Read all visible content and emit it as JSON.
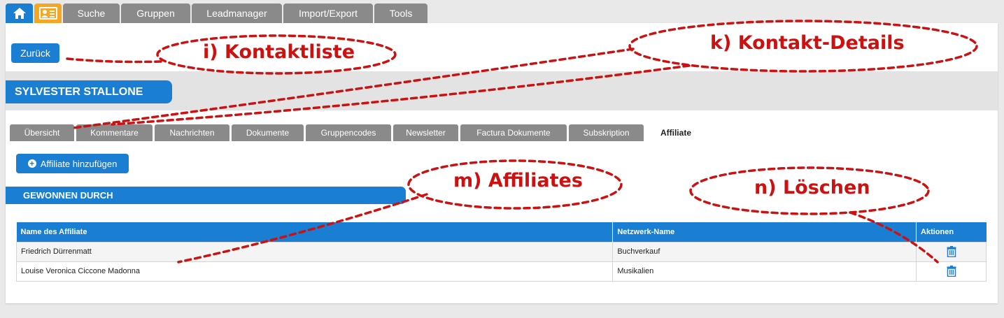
{
  "topnav": {
    "icons": [
      "home-icon",
      "contact-card-icon"
    ],
    "tabs": [
      "Suche",
      "Gruppen",
      "Leadmanager",
      "Import/Export",
      "Tools"
    ]
  },
  "back_label": "Zurück",
  "contact_name": "SYLVESTER STALLONE",
  "subtabs": [
    "Übersicht",
    "Kommentare",
    "Nachrichten",
    "Dokumente",
    "Gruppencodes",
    "Newsletter",
    "Factura Dokumente",
    "Subskription",
    "Affiliate"
  ],
  "active_subtab": "Affiliate",
  "add_affiliate_label": "Affiliate hinzufügen",
  "section_title": "GEWONNEN DURCH",
  "table": {
    "headers": [
      "Name des Affiliate",
      "Netzwerk-Name",
      "Aktionen"
    ],
    "rows": [
      {
        "name": "Friedrich Dürrenmatt",
        "network": "Buchverkauf",
        "action_icon": "trash-icon"
      },
      {
        "name": "Louise Veronica Ciccone Madonna",
        "network": "Musikalien",
        "action_icon": "trash-icon"
      }
    ]
  },
  "annotations": {
    "i": "i) Kontaktliste",
    "k": "k) Kontakt-Details",
    "m": "m) Affiliates",
    "n": "n) Löschen"
  },
  "colors": {
    "accent": "#1a7ed3",
    "contact_icon_bg": "#f5a623",
    "tab_gray": "#8a8a8a",
    "annotation_red": "#cc1111"
  }
}
